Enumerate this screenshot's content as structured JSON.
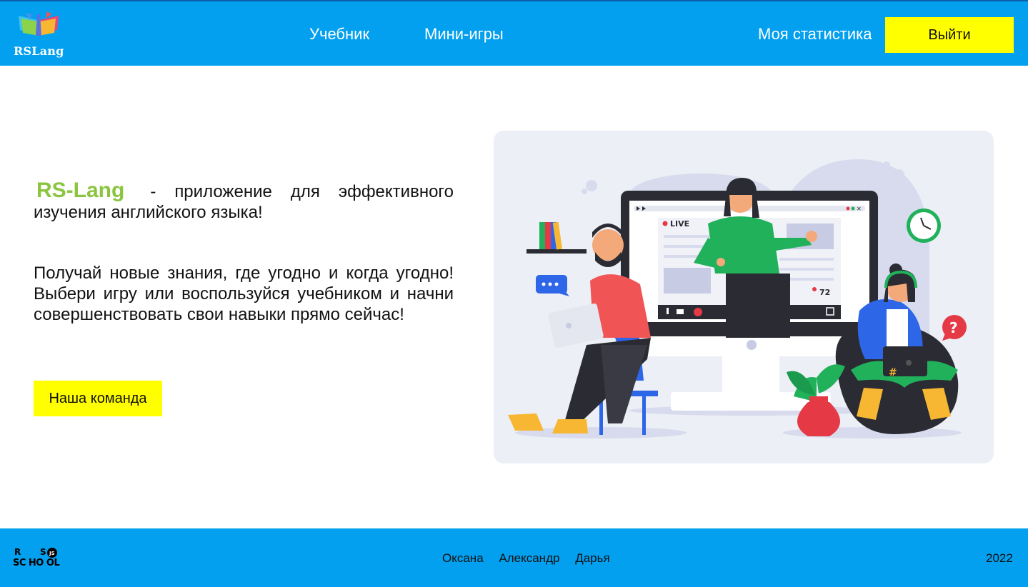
{
  "header": {
    "logo_text": "RSLang",
    "nav": {
      "textbook": "Учебник",
      "games": "Мини-игры",
      "stats": "Моя статистика"
    },
    "logout_label": "Выйти"
  },
  "main": {
    "brand": "RS-Lang",
    "intro_rest": " - приложение для эффективного изучения английского языка!",
    "description": "Получай новые знания, где угодно и когда угодно! Выбери игру или воспользуйся учебником и начни совершенствовать свои навыки прямо сейчас!",
    "team_button": "Наша команда",
    "illustration": {
      "live_label": "LIVE",
      "viewers": "72"
    }
  },
  "footer": {
    "school_logo": "RS SCHOOL",
    "authors": [
      "Оксана",
      "Александр",
      "Дарья"
    ],
    "year": "2022"
  },
  "colors": {
    "header_bg": "#03a0ef",
    "button_bg": "#ffff00",
    "brand": "#8bc53f"
  }
}
